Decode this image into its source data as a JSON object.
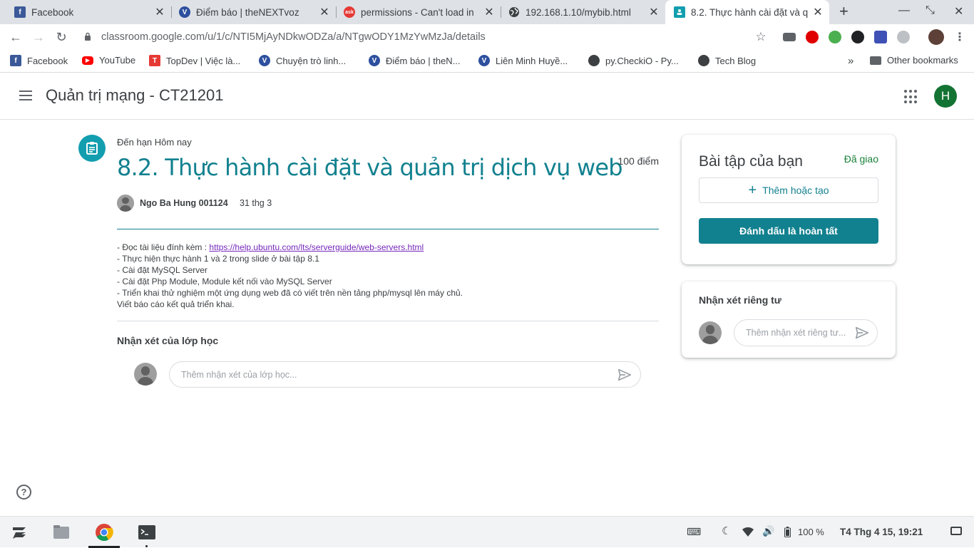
{
  "browser": {
    "tabs": [
      {
        "title": "Facebook",
        "icon": "facebook-icon",
        "color": "#3b5998",
        "glyph": "f"
      },
      {
        "title": "Điểm báo | theNEXTvoz",
        "icon": "voz-icon",
        "color": "#2d4f9e",
        "glyph": "V"
      },
      {
        "title": "permissions - Can't load in",
        "icon": "askubuntu-icon",
        "color": "#e53935",
        "glyph": "ask"
      },
      {
        "title": "192.168.1.10/mybib.html",
        "icon": "globe-icon",
        "color": "#5f6368",
        "glyph": ""
      },
      {
        "title": "8.2. Thực hành cài đặt và q",
        "icon": "classroom-icon",
        "color": "#129eaf",
        "glyph": ""
      }
    ],
    "url": "classroom.google.com/u/1/c/NTI5MjAyNDkwODZa/a/NTgwODY1MzYwMzJa/details",
    "bookmarks": [
      {
        "label": "Facebook",
        "icon": "facebook-icon",
        "color": "#3b5998",
        "glyph": "f"
      },
      {
        "label": "YouTube",
        "icon": "youtube-icon",
        "color": "#ff0000",
        "glyph": "▶"
      },
      {
        "label": "TopDev | Việc là...",
        "icon": "topdev-icon",
        "color": "#e53935",
        "glyph": "T"
      },
      {
        "label": "Chuyện trò linh...",
        "icon": "voz-icon",
        "color": "#2d4f9e",
        "glyph": "V"
      },
      {
        "label": "Điểm báo | theN...",
        "icon": "voz-icon",
        "color": "#2d4f9e",
        "glyph": "V"
      },
      {
        "label": "Liên Minh Huyề...",
        "icon": "voz-icon",
        "color": "#2d4f9e",
        "glyph": "V"
      },
      {
        "label": "py.CheckiO - Py...",
        "icon": "globe-icon",
        "color": "#3c4043",
        "glyph": ""
      },
      {
        "label": "Tech Blog",
        "icon": "globe-icon",
        "color": "#3c4043",
        "glyph": ""
      }
    ],
    "overflow": "»",
    "other_bookmarks": "Other bookmarks"
  },
  "header": {
    "class_name": "Quản trị mạng - CT21201",
    "account_initial": "H"
  },
  "assignment": {
    "due": "Đến hạn Hôm nay",
    "title": "8.2. Thực hành cài đặt và quản trị dịch vụ web",
    "points": "100 điểm",
    "author": "Ngo Ba Hung 001124",
    "date": "31 thg 3",
    "instructions": {
      "line1_prefix": "- Đọc tài liệu đính kèm : ",
      "line1_link": "https://help.ubuntu.com/lts/serverguide/web-servers.html",
      "line2": "- Thực hiện thực hành 1 và 2 trong slide ở bài tập 8.1",
      "line3": "- Cài đặt MySQL Server",
      "line4": "- Cài đặt Php Module, Module kết nối vào MySQL Server",
      "line5": "- Triển khai thử nghiệm một ứng dụng web đã có viết trên nền tảng php/mysql lên máy chủ.",
      "line6": "Viết báo cáo kết quả triển khai."
    }
  },
  "class_comments": {
    "title": "Nhận xét của lớp học",
    "placeholder": "Thêm nhận xét của lớp học..."
  },
  "your_work": {
    "title": "Bài tập của bạn",
    "status": "Đã giao",
    "add_label": "Thêm hoặc tạo",
    "done_label": "Đánh dấu là hoàn tất"
  },
  "private_comments": {
    "title": "Nhận xét riêng tư",
    "placeholder": "Thêm nhận xét riêng tư..."
  },
  "help": "?",
  "taskbar": {
    "battery": "100 %",
    "datetime": "T4 Thg 4 15, 19:21"
  },
  "colors": {
    "accent": "#12818f",
    "status_green": "#188038",
    "avatar_green": "#137333"
  }
}
